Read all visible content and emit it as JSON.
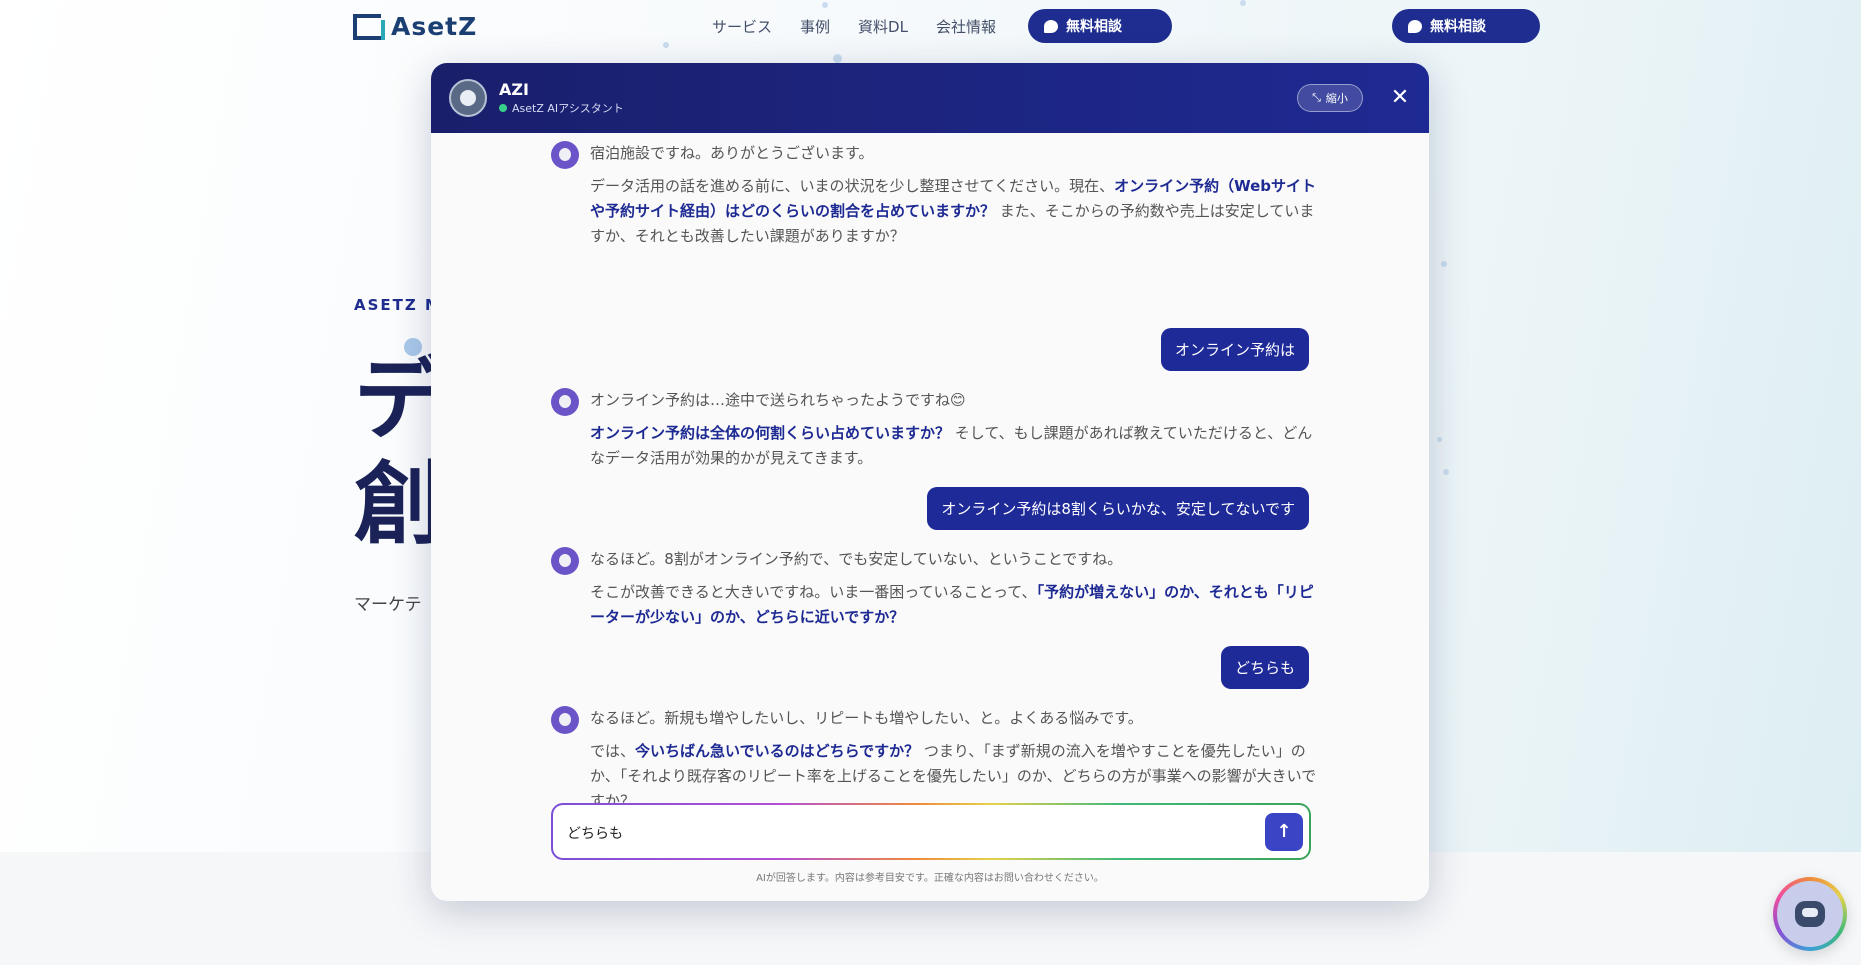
{
  "header": {
    "logo_text": "AsetZ",
    "nav": [
      "サービス",
      "事例",
      "資料DL",
      "会社情報"
    ],
    "cta_label": "無料相談",
    "cta_label_right": "無料相談"
  },
  "hero": {
    "eyebrow": "ASETZ M",
    "big_line1": "デ",
    "big_line2": "創",
    "subtitle": "マーケテ"
  },
  "chat": {
    "bot_name": "AZI",
    "bot_status": "AsetZ AIアシスタント",
    "shrink_label": "縮小",
    "close_symbol": "✕",
    "messages": [
      {
        "role": "bot",
        "p1": "宿泊施設ですね。ありがとうございます。",
        "p2_pre": "データ活用の話を進める前に、いまの状況を少し整理させてください。現在、",
        "p2_hl": "オンライン予約（Webサイトや予約サイト経由）はどのくらいの割合を占めていますか？",
        "p2_post": " また、そこからの予約数や売上は安定していますか、それとも改善したい課題がありますか？"
      },
      {
        "role": "user",
        "text": "オンライン予約は"
      },
      {
        "role": "bot",
        "p1": "オンライン予約は…途中で送られちゃったようですね😊",
        "p2_pre": "",
        "p2_hl": "オンライン予約は全体の何割くらい占めていますか？",
        "p2_post": " そして、もし課題があれば教えていただけると、どんなデータ活用が効果的かが見えてきます。"
      },
      {
        "role": "user",
        "text": "オンライン予約は8割くらいかな、安定してないです"
      },
      {
        "role": "bot",
        "p1": "なるほど。8割がオンライン予約で、でも安定していない、ということですね。",
        "p2_pre": "そこが改善できると大きいですね。いま一番困っていることって、",
        "p2_hl": "「予約が増えない」のか、それとも「リピーターが少ない」のか、どちらに近いですか？",
        "p2_post": ""
      },
      {
        "role": "user",
        "text": "どちらも"
      },
      {
        "role": "bot",
        "p1": "なるほど。新規も増やしたいし、リピートも増やしたい、と。よくある悩みです。",
        "p2_pre": "では、",
        "p2_hl": "今いちばん急いでいるのはどちらですか？",
        "p2_post": " つまり、「まず新規の流入を増やすことを優先したい」のか、「それより既存客のリピート率を上げることを優先したい」のか、どちらの方が事業への影響が大きいですか？"
      }
    ],
    "input_value": "どちらも",
    "send_symbol": "↑",
    "disclaimer": "AIが回答します。内容は参考目安です。正確な内容はお問い合わせください。"
  },
  "colors": {
    "brand_navy": "#1e2a93",
    "header_gradient_start": "#1a1f6b",
    "user_bubble": "#1f2a99",
    "online": "#39d08a"
  }
}
